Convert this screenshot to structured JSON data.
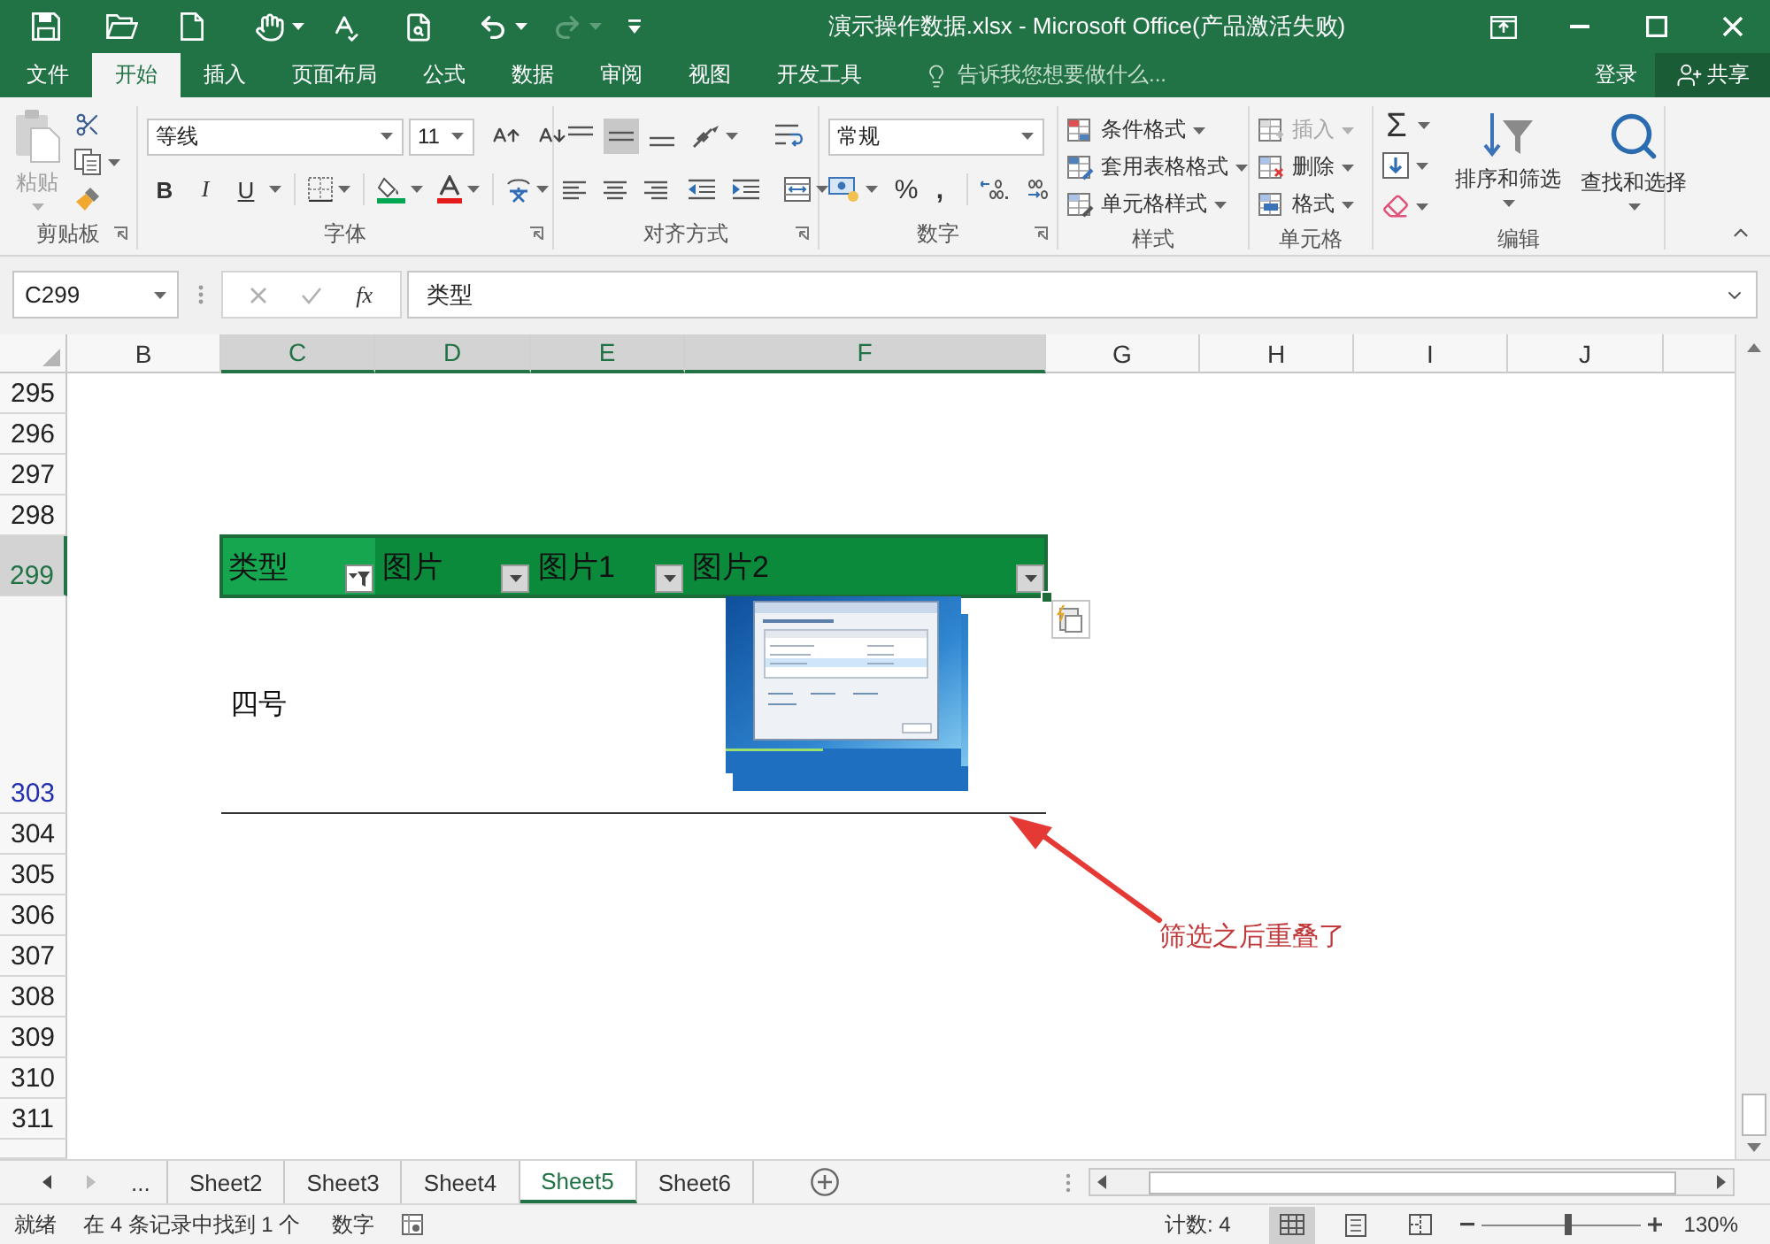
{
  "title_bar": {
    "title": "演示操作数据.xlsx - Microsoft Office(产品激活失败)"
  },
  "menu": {
    "tabs": [
      {
        "label": "文件",
        "selected": false
      },
      {
        "label": "开始",
        "selected": true
      },
      {
        "label": "插入",
        "selected": false
      },
      {
        "label": "页面布局",
        "selected": false
      },
      {
        "label": "公式",
        "selected": false
      },
      {
        "label": "数据",
        "selected": false
      },
      {
        "label": "审阅",
        "selected": false
      },
      {
        "label": "视图",
        "selected": false
      },
      {
        "label": "开发工具",
        "selected": false
      }
    ],
    "tell_me": {
      "placeholder": "告诉我您想要做什么..."
    },
    "sign_in": "登录",
    "share": "共享"
  },
  "ribbon": {
    "clipboard": {
      "label": "剪贴板",
      "paste": {
        "label": "粘贴",
        "disabled": true
      }
    },
    "font": {
      "label": "字体",
      "font_name": "等线",
      "font_size": "11",
      "bold": "B",
      "italic": "I",
      "underline": "U"
    },
    "alignment": {
      "label": "对齐方式",
      "vertical": [
        {
          "selected": false
        },
        {
          "selected": true
        },
        {
          "selected": false
        }
      ]
    },
    "number": {
      "label": "数字",
      "format": "常规",
      "percent": "%",
      "comma": ","
    },
    "styles": {
      "label": "样式",
      "items": [
        "条件格式",
        "套用表格格式",
        "单元格样式"
      ]
    },
    "cells": {
      "label": "单元格",
      "items": [
        {
          "label": "插入",
          "disabled": true
        },
        {
          "label": "删除",
          "disabled": false
        },
        {
          "label": "格式",
          "disabled": false
        }
      ]
    },
    "editing": {
      "label": "编辑",
      "sum": "Σ",
      "sort_filter": "排序和筛选",
      "find_select": "查找和选择"
    }
  },
  "formula_bar": {
    "name_box": "C299",
    "insert_function": "fx",
    "formula": "类型"
  },
  "sheet": {
    "columns": [
      {
        "label": "B",
        "selected": false
      },
      {
        "label": "C",
        "selected": true
      },
      {
        "label": "D",
        "selected": true
      },
      {
        "label": "E",
        "selected": true
      },
      {
        "label": "F",
        "selected": true
      },
      {
        "label": "G",
        "selected": false
      },
      {
        "label": "H",
        "selected": false
      },
      {
        "label": "I",
        "selected": false
      },
      {
        "label": "J",
        "selected": false
      }
    ],
    "rows": [
      {
        "number": "295",
        "kind": "empty",
        "selected": false,
        "filtered": false
      },
      {
        "number": "296",
        "kind": "empty",
        "selected": false,
        "filtered": false
      },
      {
        "number": "297",
        "kind": "empty",
        "selected": false,
        "filtered": false
      },
      {
        "number": "298",
        "kind": "empty",
        "selected": false,
        "filtered": false
      },
      {
        "number": "299",
        "kind": "table_header",
        "selected": true,
        "filtered": false
      },
      {
        "number": "303",
        "kind": "table_row",
        "selected": false,
        "filtered": true
      },
      {
        "number": "304",
        "kind": "empty",
        "selected": false,
        "filtered": false
      },
      {
        "number": "305",
        "kind": "empty",
        "selected": false,
        "filtered": false
      },
      {
        "number": "306",
        "kind": "empty",
        "selected": false,
        "filtered": false
      },
      {
        "number": "307",
        "kind": "empty",
        "selected": false,
        "filtered": false
      },
      {
        "number": "308",
        "kind": "empty",
        "selected": false,
        "filtered": false
      },
      {
        "number": "309",
        "kind": "empty",
        "selected": false,
        "filtered": false
      },
      {
        "number": "310",
        "kind": "empty",
        "selected": false,
        "filtered": false
      },
      {
        "number": "311",
        "kind": "empty",
        "selected": false,
        "filtered": false
      }
    ]
  },
  "table": {
    "headers": [
      {
        "label": "类型",
        "active": true,
        "filter_applied": true
      },
      {
        "label": "图片",
        "active": false,
        "filter_applied": false
      },
      {
        "label": "图片1",
        "active": false,
        "filter_applied": false
      },
      {
        "label": "图片2",
        "active": false,
        "filter_applied": false
      }
    ],
    "data_row": {
      "cells": [
        "四号"
      ]
    }
  },
  "annotation": {
    "text": "筛选之后重叠了"
  },
  "sheet_tabs": {
    "more": "...",
    "tabs": [
      {
        "label": "Sheet2",
        "selected": false
      },
      {
        "label": "Sheet3",
        "selected": false
      },
      {
        "label": "Sheet4",
        "selected": false
      },
      {
        "label": "Sheet5",
        "selected": true
      },
      {
        "label": "Sheet6",
        "selected": false
      }
    ]
  },
  "status_bar": {
    "ready": "就绪",
    "filter_info": "在 4 条记录中找到 1 个",
    "mode": "数字",
    "count": "计数: 4",
    "views": [
      {
        "selected": true
      },
      {
        "selected": false
      },
      {
        "selected": false
      }
    ],
    "zoom": {
      "level": 0.54,
      "reading": "130%"
    }
  }
}
